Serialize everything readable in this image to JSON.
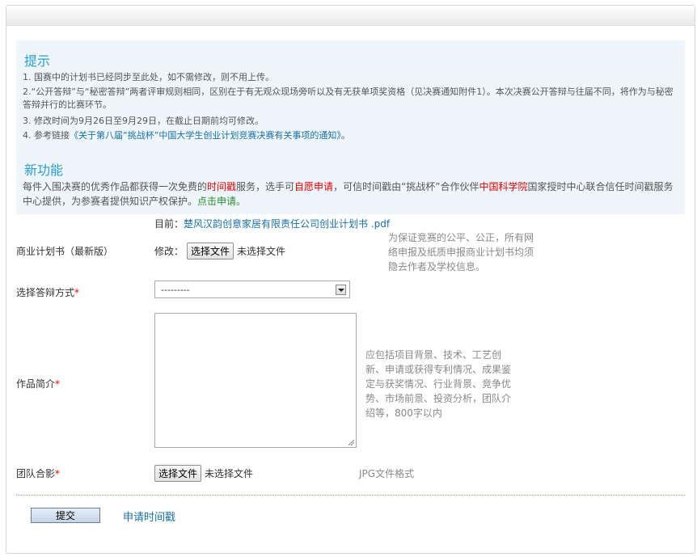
{
  "tips": {
    "title": "提示",
    "items": [
      "1. 国赛中的计划书已经同步至此处，如不需修改，则不用上传。",
      "2.“公开答辩”与“秘密答辩”两者评审规则相同，区别在于有无观众现场旁听以及有无获单项奖资格（见决赛通知附件1）。本次决赛公开答辩与往届不同，将作为与秘密答辩并行的比赛环节。",
      "3. 修改时间为9月26日至9月29日，在截止日期前均可修改。"
    ],
    "ref_prefix": "4. 参考链接",
    "ref_link": "《关于第八届“挑战杯”中国大学生创业计划竞赛决赛有关事项的通知》",
    "ref_suffix": "。"
  },
  "new_feature": {
    "title": "新功能",
    "t1": "每件入围决赛的优秀作品都获得一次免费的",
    "red1": "时间戳",
    "t2": "服务，选手可",
    "red2": "自愿申请",
    "t3": "，可信时间戳由“挑战杯”合作伙伴",
    "red3": "中国科学院",
    "t4": "国家授时中心联合信任时间戳服务中心提供，为参赛者提供知识产权保护。",
    "link": "点击申请。"
  },
  "form": {
    "plan": {
      "label": "商业计划书（最新版）",
      "current_prefix": "目前：",
      "current_file": "楚风汉韵创意家居有限责任公司创业计划书 .pdf",
      "modify_label": "修改：",
      "choose_btn": "选择文件",
      "no_file": "未选择文件",
      "hint": "为保证竞赛的公平、公正，所有网络申报及纸质申报商业计划书均须隐去作者及学校信息。"
    },
    "defense": {
      "label": "选择答辩方式",
      "required": "*",
      "selected": "---------"
    },
    "intro": {
      "label": "作品简介",
      "required": "*",
      "hint": "应包括项目背景、技术、工艺创新、申请或获得专利情况、成果鉴定与获奖情况、行业背景、竞争优势、市场前景、投资分析，团队介绍等，800字以内"
    },
    "photo": {
      "label": "团队合影",
      "required": "*",
      "choose_btn": "选择文件",
      "no_file": "未选择文件",
      "hint": "JPG文件格式"
    }
  },
  "actions": {
    "submit": "提交",
    "timestamp_link": "申请时间戳"
  }
}
